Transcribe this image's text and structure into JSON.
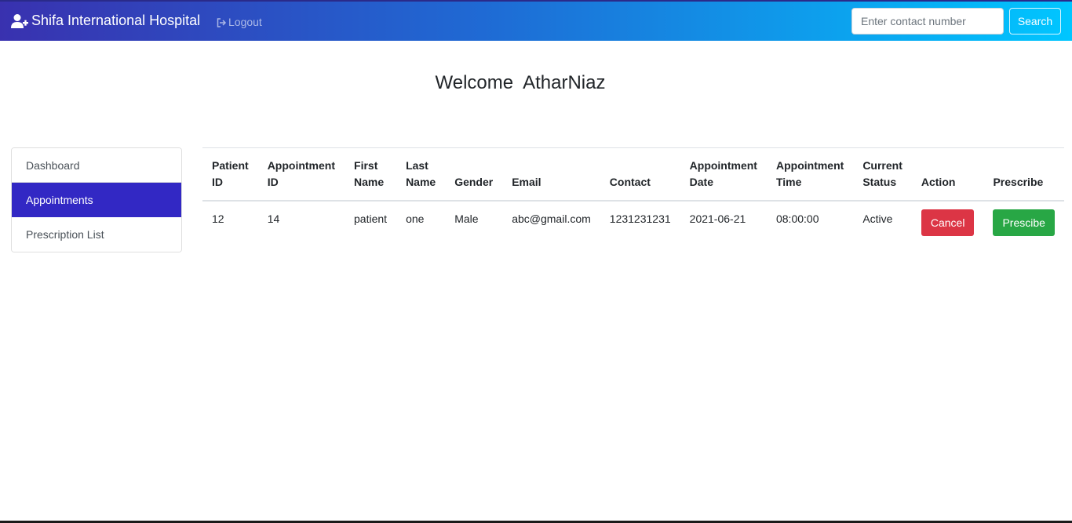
{
  "navbar": {
    "brand_icon": "user-plus-icon",
    "brand": "Shifa International Hospital",
    "logout_icon": "sign-out-icon",
    "logout": "Logout",
    "search_placeholder": "Enter contact number",
    "search_value": "",
    "search_button": "Search",
    "gradient_colors": [
      "#3931af",
      "#1f6ad4",
      "#00c6ff"
    ]
  },
  "welcome": "Welcome  AtharNiaz",
  "sidebar": {
    "items": [
      {
        "label": "Dashboard",
        "active": false
      },
      {
        "label": "Appointments",
        "active": true
      },
      {
        "label": "Prescription List",
        "active": false
      }
    ],
    "active_color": "#3228c4"
  },
  "table": {
    "headers": [
      "Patient ID",
      "Appointment ID",
      "First Name",
      "Last Name",
      "Gender",
      "Email",
      "Contact",
      "Appointment Date",
      "Appointment Time",
      "Current Status",
      "Action",
      "Prescribe"
    ],
    "rows": [
      {
        "patient_id": "12",
        "appointment_id": "14",
        "first_name": "patient",
        "last_name": "one",
        "gender": "Male",
        "email": "abc@gmail.com",
        "contact": "1231231231",
        "appointment_date": "2021-06-21",
        "appointment_time": "08:00:00",
        "status": "Active",
        "action_label": "Cancel",
        "prescribe_label": "Prescibe"
      }
    ],
    "colors": {
      "cancel": "#dc3545",
      "prescribe": "#28a745"
    }
  }
}
